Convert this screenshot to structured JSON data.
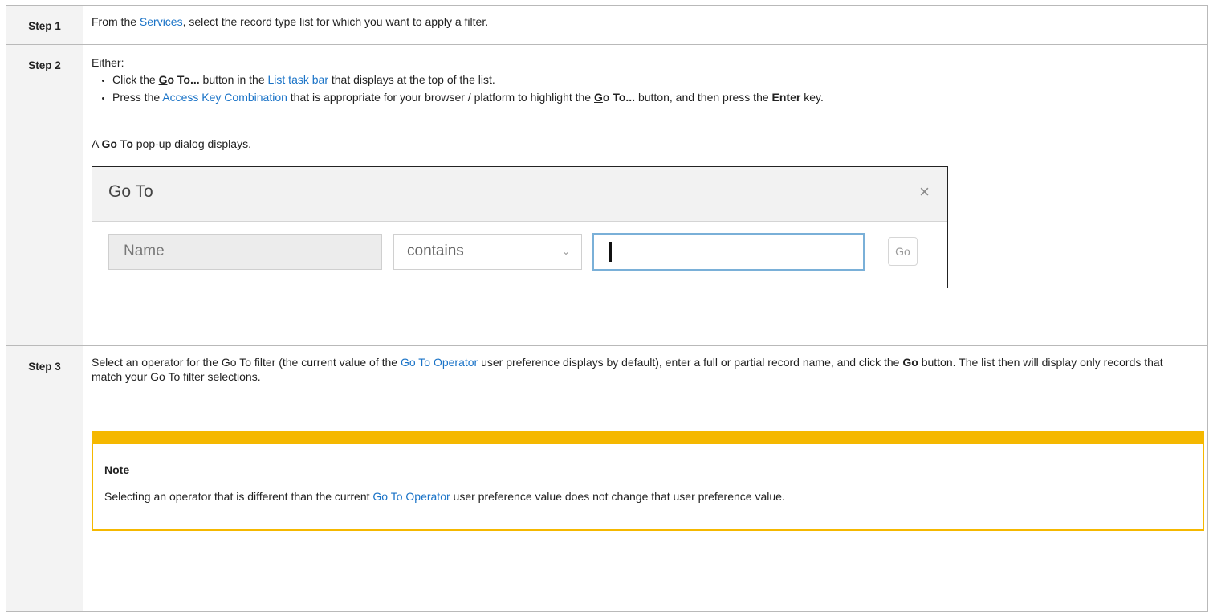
{
  "steps": {
    "s1": {
      "label": "Step 1",
      "t1": "From the ",
      "link1": "Services",
      "t2": ", select the record type list for which you want to apply a filter."
    },
    "s2": {
      "label": "Step 2",
      "either": "Either:",
      "b1_t1": "Click the ",
      "b1_go_under": "G",
      "b1_go_rest": "o To...",
      "b1_t2": " button in the ",
      "b1_link": "List task bar",
      "b1_t3": " that displays at the top of the list.",
      "b2_t1": "Press the ",
      "b2_link": "Access Key Combination",
      "b2_t2": " that is appropriate for your browser / platform to highlight the ",
      "b2_go_under": "G",
      "b2_go_rest": "o To...",
      "b2_t3": " button, and then press the ",
      "b2_enter": "Enter",
      "b2_t4": " key.",
      "after_t1": "A ",
      "after_bold": "Go To",
      "after_t2": " pop-up dialog displays."
    },
    "s3": {
      "label": "Step 3",
      "t1": "Select an operator for the Go To filter (the current value of the ",
      "link": "Go To Operator",
      "t2": " user preference displays by default), enter a full or partial record name, and click the ",
      "go": "Go",
      "t3": " button. The list then will display only records that match your Go To filter selections."
    }
  },
  "dialog": {
    "title": "Go To",
    "close": "×",
    "field_name": "Name",
    "operator": "contains",
    "chevron": "⌄",
    "go_button": "Go"
  },
  "note": {
    "title": "Note",
    "t1": "Selecting an operator that is different than the current ",
    "link": "Go To Operator",
    "t2": " user preference value does not change that user preference value."
  },
  "colors": {
    "link": "#1a73c7",
    "note_accent": "#f5b800",
    "label_bg": "#f3f3f3"
  }
}
